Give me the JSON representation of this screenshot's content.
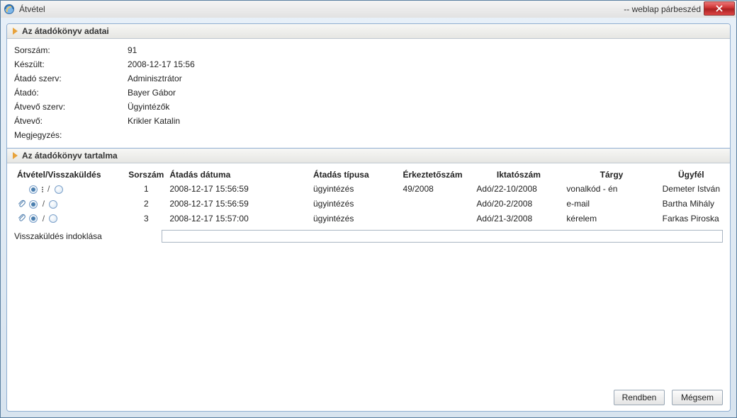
{
  "window": {
    "title": "Átvétel",
    "subtitle": "-- weblap párbeszéd"
  },
  "section1": {
    "header": "Az átadókönyv adatai",
    "rows": [
      {
        "label": "Sorszám:",
        "value": "91"
      },
      {
        "label": "Készült:",
        "value": "2008-12-17 15:56"
      },
      {
        "label": "Átadó szerv:",
        "value": "Adminisztrátor"
      },
      {
        "label": "Átadó:",
        "value": "Bayer Gábor"
      },
      {
        "label": "Átvevő szerv:",
        "value": "Ügyintézők"
      },
      {
        "label": "Átvevő:",
        "value": "Krikler Katalin"
      },
      {
        "label": "Megjegyzés:",
        "value": ""
      }
    ]
  },
  "section2": {
    "header": "Az átadókönyv tartalma",
    "columns": [
      "Átvétel/Visszaküldés",
      "Sorszám",
      "Átadás dátuma",
      "Átadás típusa",
      "Érkeztetőszám",
      "Iktatószám",
      "Tárgy",
      "Ügyfél"
    ],
    "rows": [
      {
        "sorszam": "1",
        "datum": "2008-12-17 15:56:59",
        "tipus": "ügyintézés",
        "erk": "49/2008",
        "ikt": "Adó/22-10/2008",
        "targy": "vonalkód - én",
        "ugyfel": "Demeter István"
      },
      {
        "sorszam": "2",
        "datum": "2008-12-17 15:56:59",
        "tipus": "ügyintézés",
        "erk": "",
        "ikt": "Adó/20-2/2008",
        "targy": "e-mail",
        "ugyfel": "Bartha Mihály"
      },
      {
        "sorszam": "3",
        "datum": "2008-12-17 15:57:00",
        "tipus": "ügyintézés",
        "erk": "",
        "ikt": "Adó/21-3/2008",
        "targy": "kérelem",
        "ugyfel": "Farkas Piroska"
      }
    ],
    "reason_label": "Visszaküldés indoklása",
    "reason_value": ""
  },
  "buttons": {
    "ok": "Rendben",
    "cancel": "Mégsem"
  },
  "radio_separator": "/"
}
